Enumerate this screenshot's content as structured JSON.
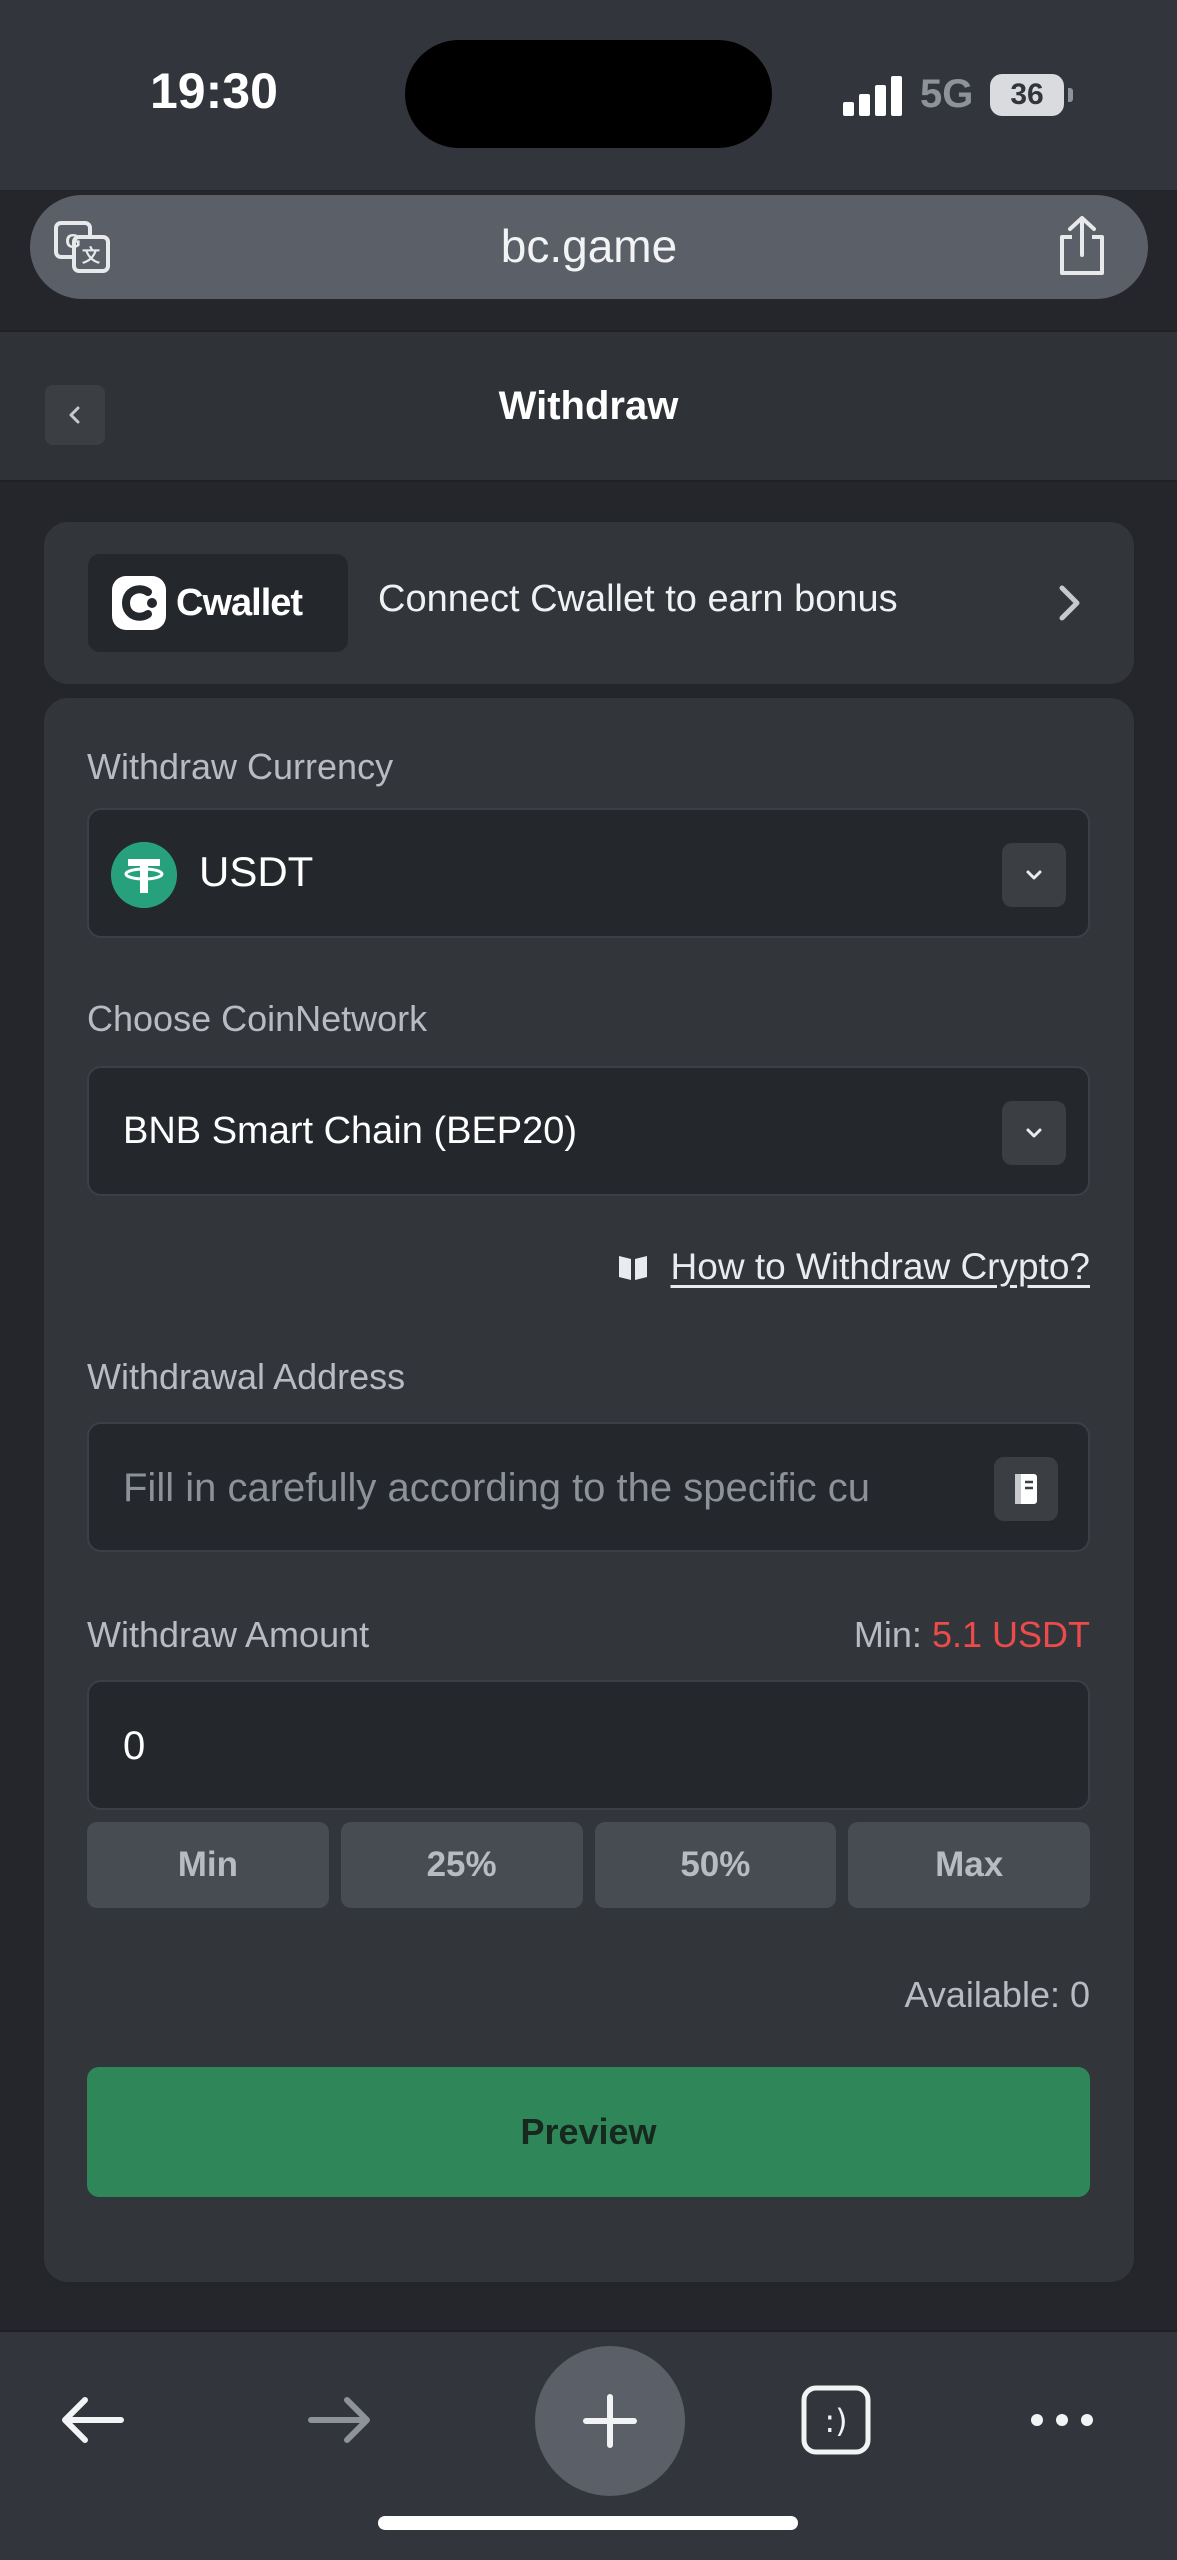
{
  "status_bar": {
    "time": "19:30",
    "network": "5G",
    "battery": "36"
  },
  "browser": {
    "url": "bc.game"
  },
  "header": {
    "title": "Withdraw"
  },
  "cwallet": {
    "logo_text": "Cwallet",
    "promo": "Connect Cwallet to earn bonus"
  },
  "form": {
    "currency_label": "Withdraw Currency",
    "currency_value": "USDT",
    "network_label": "Choose CoinNetwork",
    "network_value": "BNB Smart Chain (BEP20)",
    "howto_link": "How to Withdraw Crypto?",
    "address_label": "Withdrawal Address",
    "address_placeholder": "Fill in carefully according to the specific cu",
    "amount_label": "Withdraw Amount",
    "min_label": "Min:",
    "min_value": "5.1 USDT",
    "amount_value": "0",
    "pct_buttons": [
      "Min",
      "25%",
      "50%",
      "Max"
    ],
    "available": "Available: 0",
    "preview_button": "Preview"
  },
  "colors": {
    "accent": "#2e8659",
    "min_red": "#ed4b4b",
    "tether": "#26a17b"
  }
}
